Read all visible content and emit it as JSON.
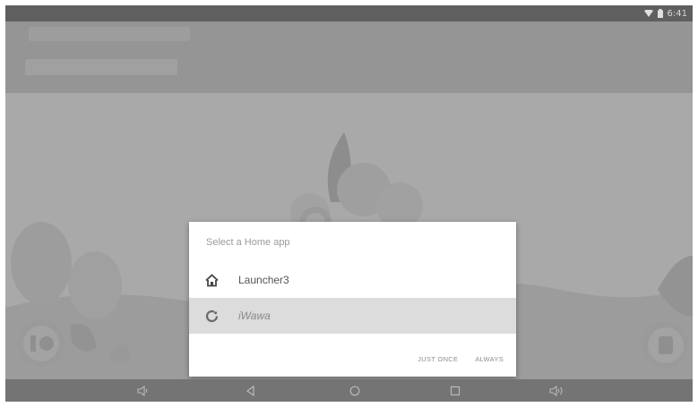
{
  "status_bar": {
    "time": "6:41",
    "icons": [
      "wifi-icon",
      "battery-icon"
    ]
  },
  "launcher_chooser": {
    "title": "Select a Home app",
    "apps": [
      {
        "label": "Launcher3",
        "icon": "home-icon",
        "selected": false
      },
      {
        "label": "iWawa",
        "icon": "iwawa-icon",
        "selected": true
      }
    ],
    "actions": {
      "just_once": "JUST ONCE",
      "always": "ALWAYS"
    }
  },
  "nav_bar": {
    "buttons": [
      "volume-down-icon",
      "back-icon",
      "home-icon",
      "recents-icon",
      "volume-up-icon"
    ]
  },
  "colors": {
    "dim_overlay": "#a4a4a4",
    "dialog_background": "#ffffff",
    "selected_row": "#dcdcdc",
    "nav_bar": "#747474",
    "status_bar": "#5f5f5f"
  }
}
